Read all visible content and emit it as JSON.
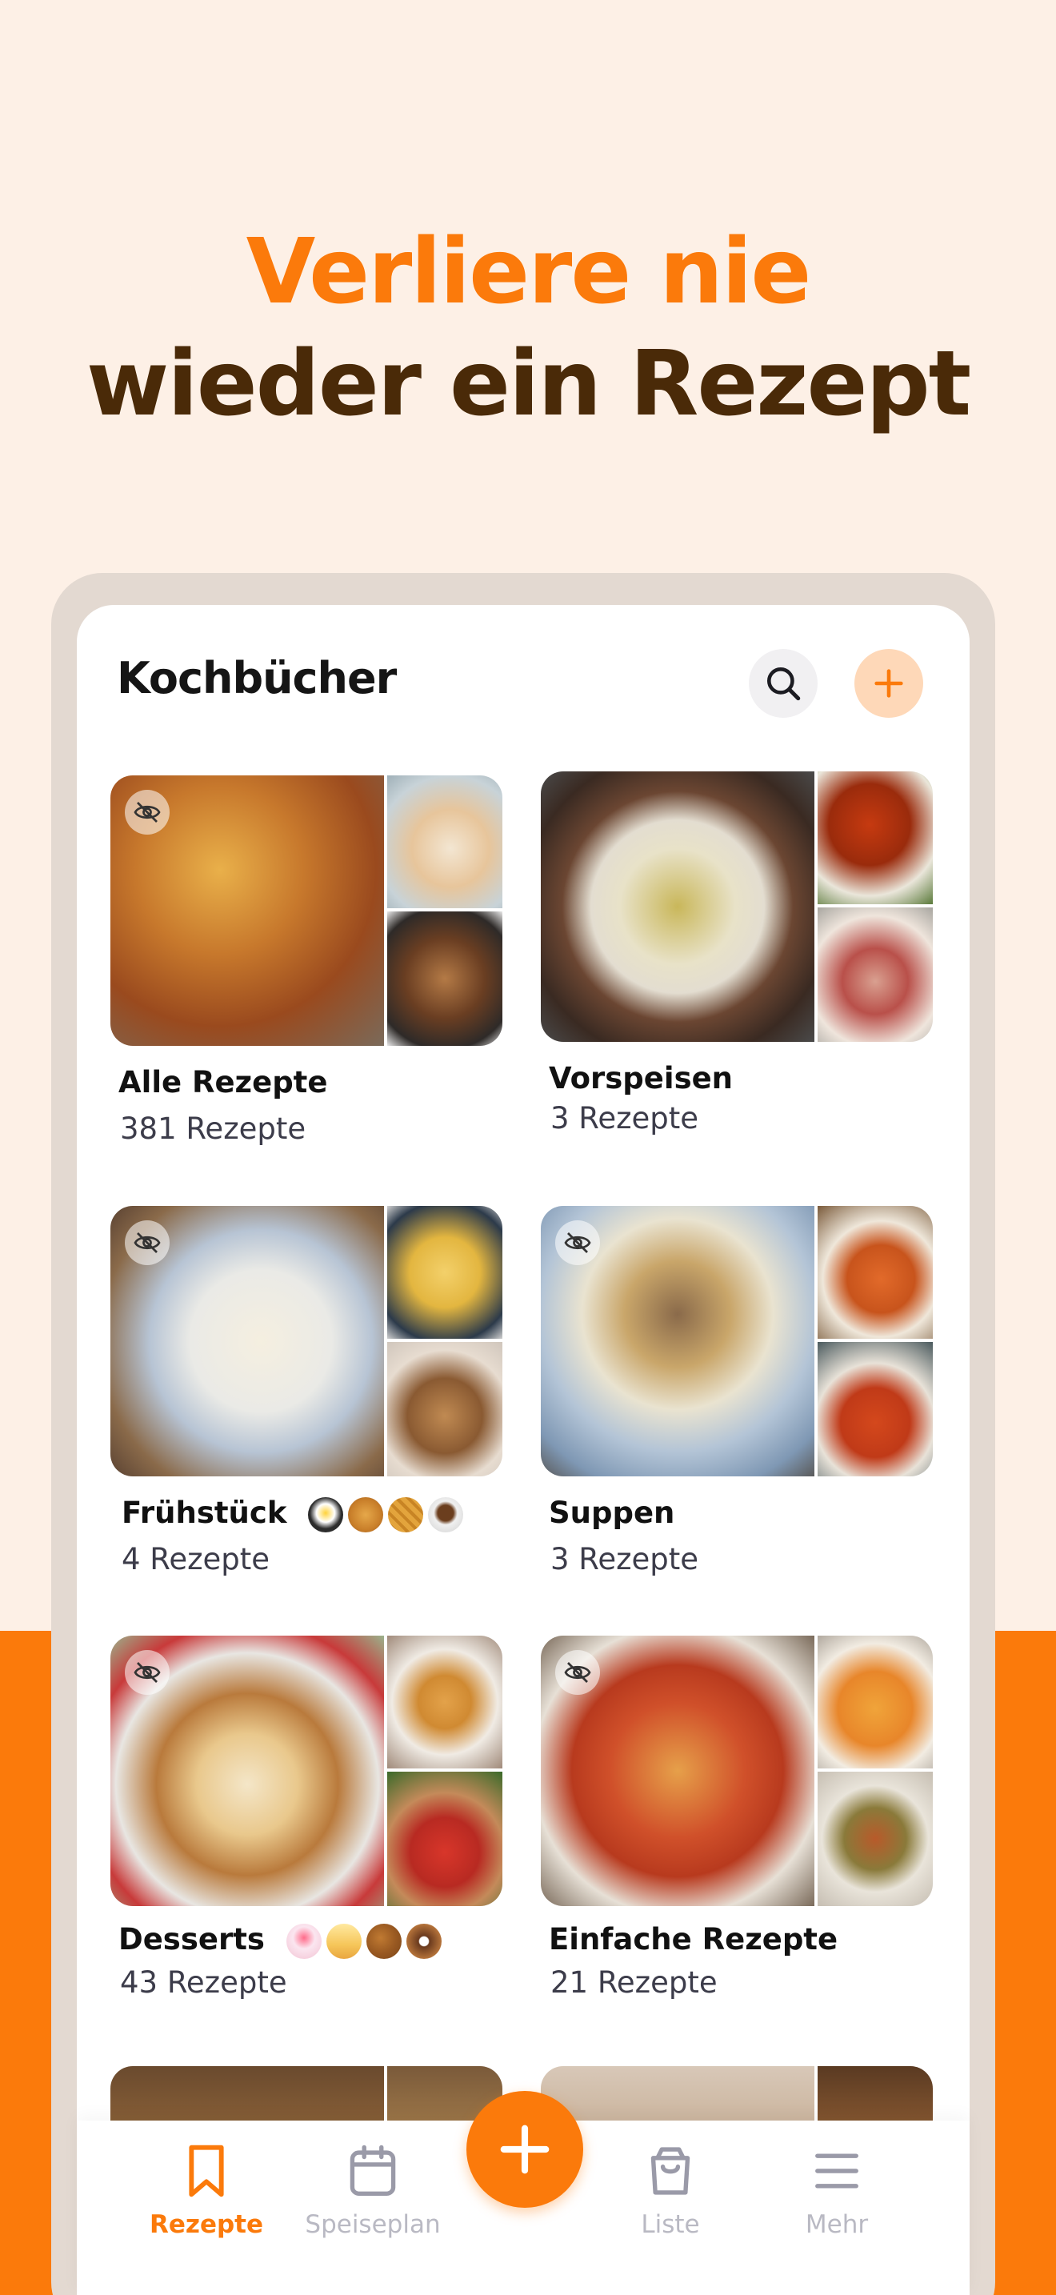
{
  "headline": {
    "line1": "Verliere nie",
    "line2": "wieder ein Rezept"
  },
  "colors": {
    "accent": "#fb7a0b",
    "headline_dark": "#4a2a08",
    "background": "#fdf0e6"
  },
  "header": {
    "title": "Kochbücher",
    "search_icon": "search-icon",
    "add_icon": "plus-icon"
  },
  "cookbooks": [
    {
      "name": "Alle Rezepte",
      "count": "381 Rezepte",
      "hidden": true,
      "emojis": []
    },
    {
      "name": "Vorspeisen",
      "count": "3 Rezepte",
      "hidden": false,
      "emojis": []
    },
    {
      "name": "Frühstück",
      "count": "4  Rezepte",
      "hidden": true,
      "emojis": [
        "🍳",
        "🥞",
        "🧇",
        "☕"
      ]
    },
    {
      "name": "Suppen",
      "count": "3  Rezepte",
      "hidden": true,
      "emojis": []
    },
    {
      "name": "Desserts",
      "count": "43  Rezepte",
      "hidden": true,
      "emojis": [
        "🎂",
        "🍰",
        "🍪",
        "🍩"
      ]
    },
    {
      "name": "Einfache Rezepte",
      "count": "21  Rezepte",
      "hidden": true,
      "emojis": []
    }
  ],
  "bottom_nav": {
    "items": [
      {
        "label": "Rezepte",
        "icon": "bookmark-icon",
        "active": true
      },
      {
        "label": "Speiseplan",
        "icon": "calendar-icon",
        "active": false
      },
      {
        "label": "Liste",
        "icon": "shopping-bag-icon",
        "active": false
      },
      {
        "label": "Mehr",
        "icon": "menu-icon",
        "active": false
      }
    ],
    "fab_icon": "plus-icon"
  }
}
